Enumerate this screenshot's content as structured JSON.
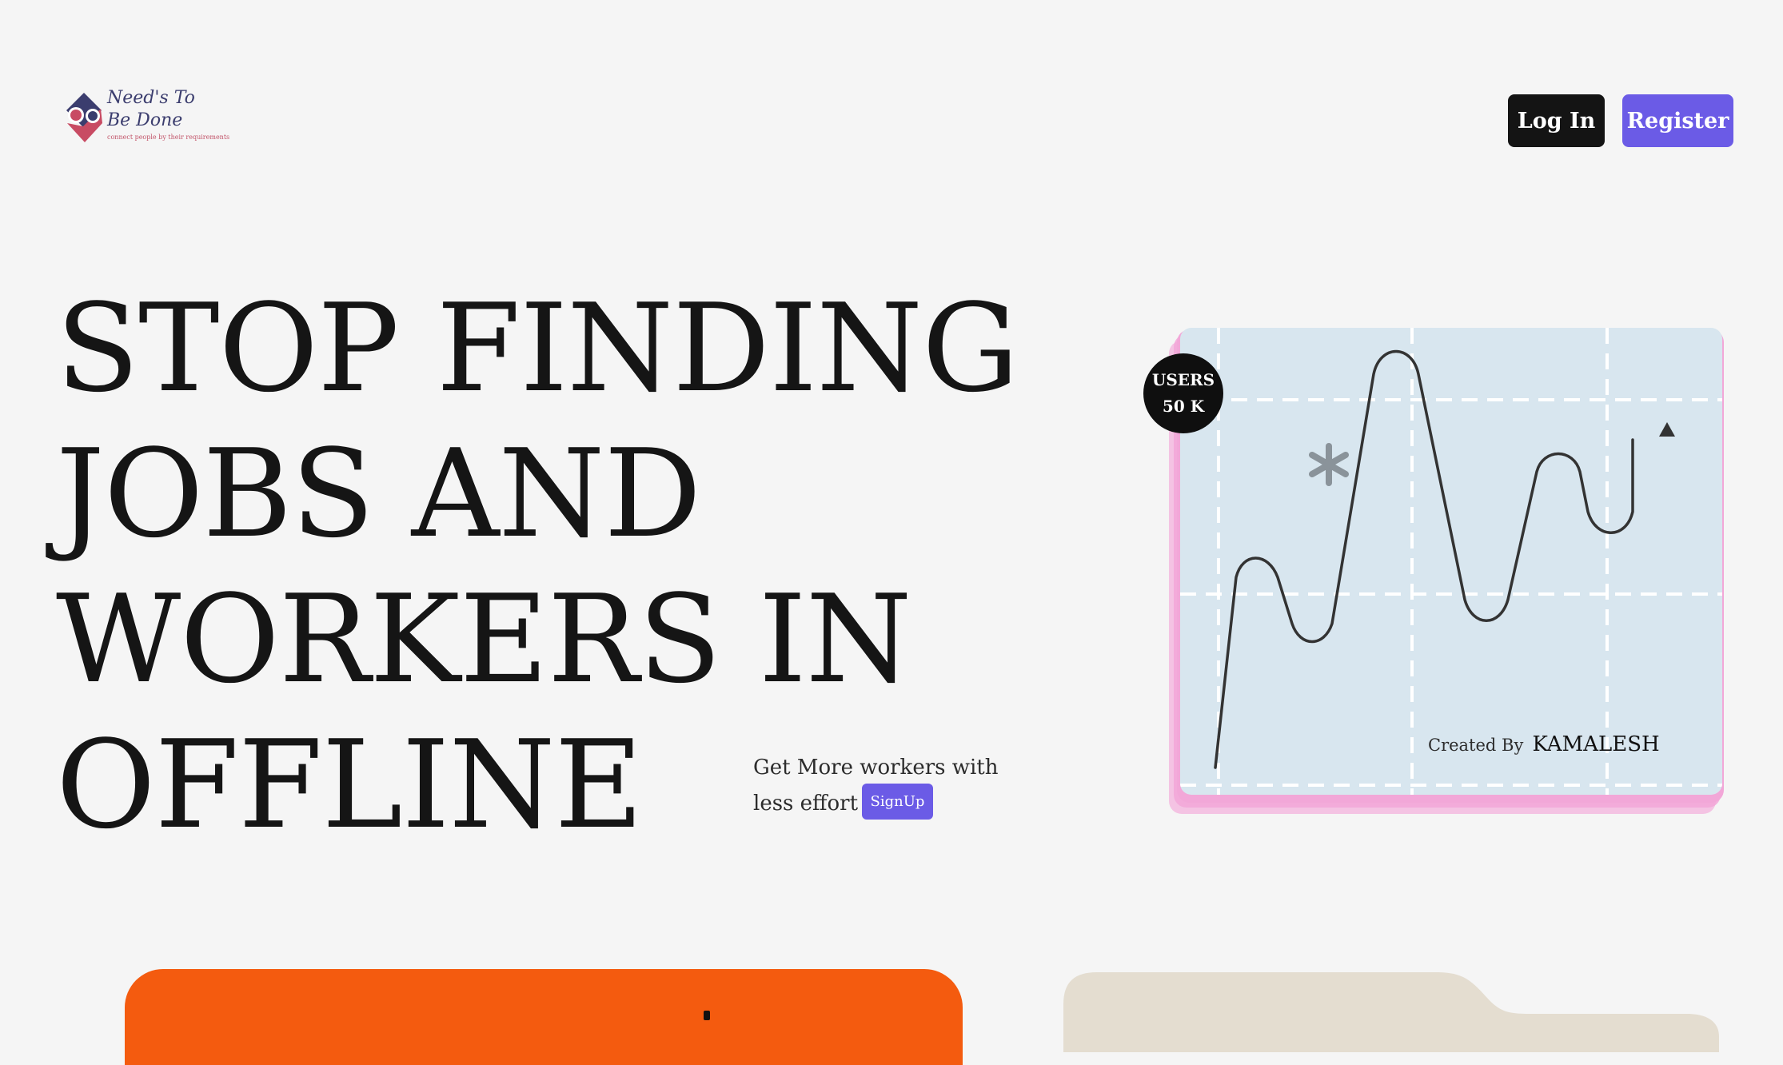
{
  "header": {
    "logo": {
      "line1": "Need's To",
      "line2": "Be Done",
      "tagline": "connect people by their requirements",
      "icon": "diamond-logo-icon"
    },
    "login_label": "Log In",
    "register_label": "Register"
  },
  "hero": {
    "title_lines": [
      "STOP FINDING",
      "JOBS AND",
      "WORKERS IN",
      "OFFLINE"
    ],
    "cta_text_line1": "Get More workers with",
    "cta_text_line2": "less effort",
    "signup_label": "SignUp"
  },
  "stats": {
    "users_label": "USERS",
    "users_value": "50 K"
  },
  "card": {
    "decoration_icon": "asterisk-icon",
    "arrow_icon": "arrow-up-icon",
    "created_by_label": "Created By",
    "creator_name": "KAMALESH"
  },
  "colors": {
    "background": "#f5f5f5",
    "primary": "#6b5be6",
    "dark": "#141414",
    "card": "#d8e6ef",
    "card_shadow": "#f2a7d8",
    "orange": "#f45b0f",
    "tan": "#e4ddd0"
  }
}
